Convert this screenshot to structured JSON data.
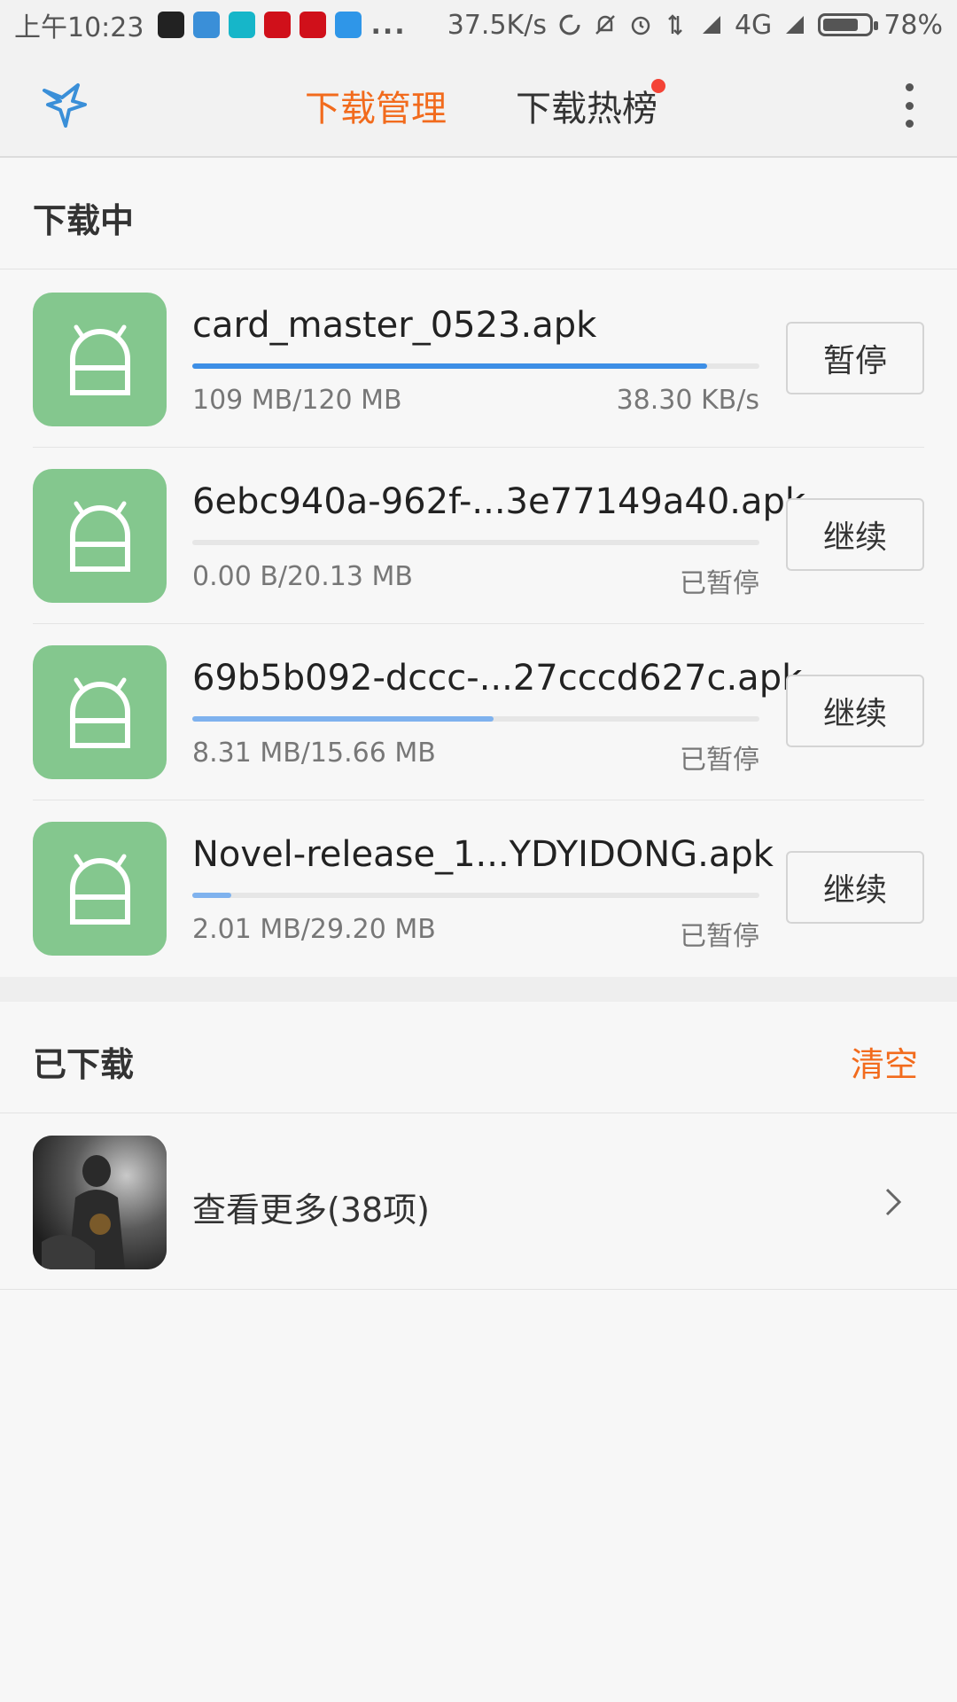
{
  "status_bar": {
    "time": "上午10:23",
    "overflow": "...",
    "speed": "37.5K/s",
    "network": "4G",
    "battery_level": 0.78,
    "battery": "78%"
  },
  "nav": {
    "tabs": [
      {
        "label": "下载管理",
        "active": true
      },
      {
        "label": "下载热榜",
        "active": false
      }
    ],
    "accent_color": "#f26b1d"
  },
  "downloading": {
    "title": "下载中",
    "items": [
      {
        "name": "card_master_0523.apk",
        "progress": 0.908,
        "size": "109 MB/120 MB",
        "status": "38.30 KB/s",
        "action": "暂停"
      },
      {
        "name": "6ebc940a-962f-...3e77149a40.apk",
        "progress": 0.0,
        "size": "0.00 B/20.13 MB",
        "status": "已暂停",
        "action": "继续"
      },
      {
        "name": "69b5b092-dccc-...27cccd627c.apk",
        "progress": 0.531,
        "size": "8.31 MB/15.66 MB",
        "status": "已暂停",
        "action": "继续"
      },
      {
        "name": "Novel-release_1...YDYIDONG.apk",
        "progress": 0.069,
        "size": "2.01 MB/29.20 MB",
        "status": "已暂停",
        "action": "继续"
      }
    ]
  },
  "downloaded": {
    "title": "已下载",
    "clear_label": "清空",
    "more_label": "查看更多(38项)"
  }
}
